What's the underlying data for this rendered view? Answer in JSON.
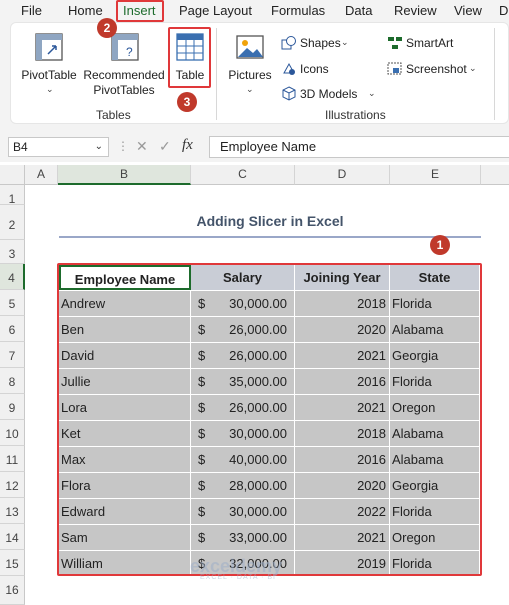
{
  "menu": {
    "items": [
      "File",
      "Home",
      "Insert",
      "Page Layout",
      "Formulas",
      "Data",
      "Review",
      "View",
      "D"
    ],
    "active": "Insert"
  },
  "ribbon": {
    "pivottable": "PivotTable",
    "recommended_line1": "Recommended",
    "recommended_line2": "PivotTables",
    "table": "Table",
    "tables_group": "Tables",
    "pictures": "Pictures",
    "shapes": "Shapes",
    "icons": "Icons",
    "models_3d": "3D Models",
    "smartart": "SmartArt",
    "screenshot": "Screenshot",
    "illustrations_group": "Illustrations"
  },
  "formula_bar": {
    "name_box": "B4",
    "fx": "fx",
    "content": "Employee Name"
  },
  "grid": {
    "columns": [
      "A",
      "B",
      "C",
      "D",
      "E"
    ],
    "rows": [
      "1",
      "2",
      "3",
      "4",
      "5",
      "6",
      "7",
      "8",
      "9",
      "10",
      "11",
      "12",
      "13",
      "14",
      "15",
      "16"
    ]
  },
  "sheet": {
    "title": "Adding Slicer in Excel",
    "headers": [
      "Employee Name",
      "Salary",
      "Joining Year",
      "State"
    ],
    "currency_symbol": "$",
    "rows": [
      {
        "name": "Andrew",
        "salary": "30,000.00",
        "year": "2018",
        "state": "Florida"
      },
      {
        "name": "Ben",
        "salary": "26,000.00",
        "year": "2020",
        "state": "Alabama"
      },
      {
        "name": "David",
        "salary": "26,000.00",
        "year": "2021",
        "state": "Georgia"
      },
      {
        "name": "Jullie",
        "salary": "35,000.00",
        "year": "2016",
        "state": "Florida"
      },
      {
        "name": "Lora",
        "salary": "26,000.00",
        "year": "2021",
        "state": "Oregon"
      },
      {
        "name": "Ket",
        "salary": "30,000.00",
        "year": "2018",
        "state": "Alabama"
      },
      {
        "name": "Max",
        "salary": "40,000.00",
        "year": "2016",
        "state": "Alabama"
      },
      {
        "name": "Flora",
        "salary": "28,000.00",
        "year": "2020",
        "state": "Georgia"
      },
      {
        "name": "Edward",
        "salary": "30,000.00",
        "year": "2022",
        "state": "Florida"
      },
      {
        "name": "Sam",
        "salary": "33,000.00",
        "year": "2021",
        "state": "Oregon"
      },
      {
        "name": "William",
        "salary": "32,000.00",
        "year": "2019",
        "state": "Florida"
      }
    ]
  },
  "annotations": {
    "step1": "1",
    "step2": "2",
    "step3": "3",
    "highlight_color": "#e0383a",
    "badge_color": "#c0392b"
  },
  "watermark": {
    "brand": "exceldemy",
    "tagline": "EXCEL · DATA · BI"
  },
  "colors": {
    "header_fill": "#c9cdd6",
    "body_fill": "#c6c6c6",
    "title_color": "#44546a",
    "excel_green": "#1d6b2c"
  }
}
